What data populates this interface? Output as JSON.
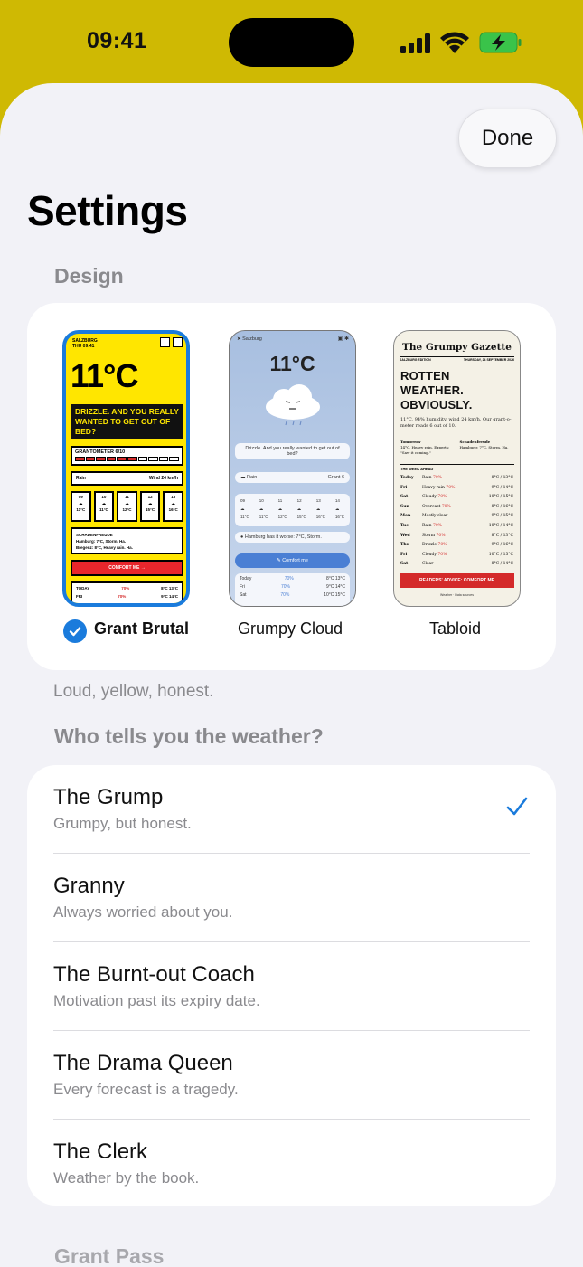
{
  "status_bar": {
    "time": "09:41"
  },
  "sheet": {
    "done_label": "Done",
    "title": "Settings"
  },
  "design": {
    "section_label": "Design",
    "description": "Loud, yellow, honest.",
    "selected": "Grant Brutal",
    "options": [
      {
        "label": "Grant Brutal",
        "selected": true
      },
      {
        "label": "Grumpy Cloud",
        "selected": false
      },
      {
        "label": "Tabloid",
        "selected": false
      }
    ],
    "preview_brutal": {
      "location": "SALZBURG",
      "date": "THU 09:41",
      "temp": "11°C",
      "banner": "DRIZZLE. AND YOU REALLY WANTED TO GET OUT OF BED?",
      "meter_title": "GRANTOMETER 6/10",
      "rain_label": "Rain",
      "wind": "Wind 24 km/h",
      "hours": [
        "09",
        "10",
        "11",
        "12",
        "13"
      ],
      "hour_temps": [
        "11°C",
        "11°C",
        "12°C",
        "15°C",
        "16°C"
      ],
      "schadenfreude_title": "SCHADENFREUDE",
      "schadenfreude_1": "Hamburg: 7°C, Storm. Ha.",
      "schadenfreude_2": "Bregenz: 8°C, Heavy rain. Ha.",
      "comfort": "COMFORT ME →",
      "row_today": "TODAY",
      "row_fri": "FRI",
      "today_pct": "70%",
      "today_range": "8°C 13°C",
      "fri_pct": "70%",
      "fri_range": "9°C 14°C"
    },
    "preview_cloud": {
      "location": "Salzburg",
      "temp": "11°C",
      "quote": "Drizzle. And you really wanted to get out of bed?",
      "rain_label": "Rain",
      "grant": "Grant 6",
      "hours": [
        "09",
        "10",
        "11",
        "12",
        "13",
        "14"
      ],
      "hour_temps": [
        "11°C",
        "11°C",
        "12°C",
        "15°C",
        "16°C",
        "16°C"
      ],
      "hamburg": "Hamburg has it worse: 7°C, Storm.",
      "comfort": "Comfort me",
      "table": [
        {
          "day": "Today",
          "pct": "70%",
          "range": "8°C 13°C"
        },
        {
          "day": "Fri",
          "pct": "70%",
          "range": "9°C 14°C"
        },
        {
          "day": "Sat",
          "pct": "70%",
          "range": "10°C 15°C"
        }
      ]
    },
    "preview_tabloid": {
      "masthead": "The Grumpy Gazette",
      "edition": "SALZBURG EDITION",
      "date": "THURSDAY, 24 SEPTEMBER 2026",
      "headline_1": "ROTTEN",
      "headline_2": "WEATHER.",
      "headline_3": "OBVIOUSLY.",
      "sub": "11°C, 94% humidity, wind 24 km/h. Our grant-o-meter reads 6 out of 10.",
      "tomorrow_title": "Tomorrow",
      "tomorrow_text": "14°C, Heavy rain. Experts: \"Saw it coming.\"",
      "schaden_title": "Schadenfreude",
      "schaden_text": "Hamburg: 7°C, Storm. Ha.",
      "week_title": "THE WEEK AHEAD",
      "week": [
        {
          "day": "Today",
          "cond": "Rain",
          "pct": "70%",
          "temp": "8°C / 13°C"
        },
        {
          "day": "Fri",
          "cond": "Heavy rain",
          "pct": "70%",
          "temp": "9°C / 14°C"
        },
        {
          "day": "Sat",
          "cond": "Cloudy",
          "pct": "70%",
          "temp": "10°C / 15°C"
        },
        {
          "day": "Sun",
          "cond": "Overcast",
          "pct": "70%",
          "temp": "8°C / 16°C"
        },
        {
          "day": "Mon",
          "cond": "Mostly clear",
          "pct": "",
          "temp": "9°C / 15°C"
        },
        {
          "day": "Tue",
          "cond": "Rain",
          "pct": "70%",
          "temp": "10°C / 14°C"
        },
        {
          "day": "Wed",
          "cond": "Storm",
          "pct": "70%",
          "temp": "8°C / 13°C"
        },
        {
          "day": "Thu",
          "cond": "Drizzle",
          "pct": "70%",
          "temp": "9°C / 16°C"
        },
        {
          "day": "Fri",
          "cond": "Cloudy",
          "pct": "70%",
          "temp": "10°C / 13°C"
        },
        {
          "day": "Sat",
          "cond": "Clear",
          "pct": "",
          "temp": "8°C / 14°C"
        }
      ],
      "advice": "READERS' ADVICE: COMFORT ME",
      "footer": "Weather · Data sources"
    }
  },
  "weather_teller": {
    "section_label": "Who tells you the weather?",
    "items": [
      {
        "title": "The Grump",
        "subtitle": "Grumpy, but honest.",
        "selected": true
      },
      {
        "title": "Granny",
        "subtitle": "Always worried about you.",
        "selected": false
      },
      {
        "title": "The Burnt-out Coach",
        "subtitle": "Motivation past its expiry date.",
        "selected": false
      },
      {
        "title": "The Drama Queen",
        "subtitle": "Every forecast is a tragedy.",
        "selected": false
      },
      {
        "title": "The Clerk",
        "subtitle": "Weather by the book.",
        "selected": false
      }
    ]
  },
  "next_section": {
    "label": "Grant Pass"
  },
  "colors": {
    "background_yellow": "#cfb903",
    "sheet_bg": "#f2f2f7",
    "accent_blue": "#1a7bdc",
    "brutal_yellow": "#ffe600",
    "alert_red": "#d42a2a"
  }
}
